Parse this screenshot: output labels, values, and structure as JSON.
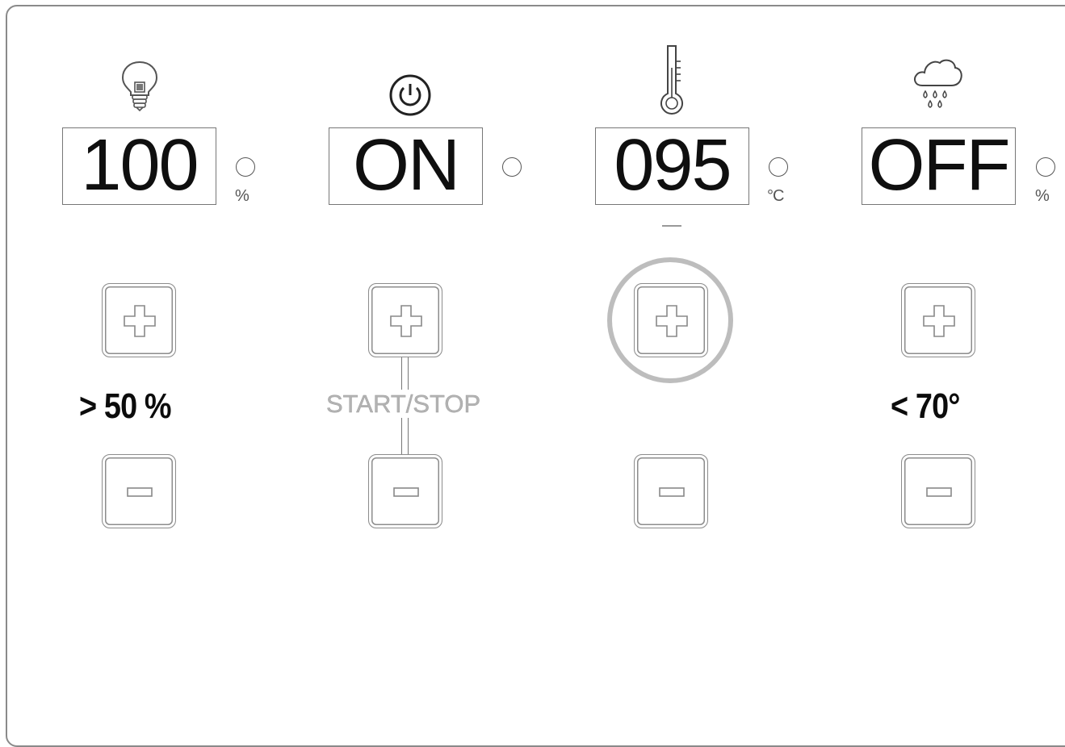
{
  "channels": [
    {
      "id": "light",
      "icon": "lightbulb-icon",
      "display_value": "100",
      "unit": "%",
      "condition": "> 50 %"
    },
    {
      "id": "power",
      "icon": "power-icon",
      "display_value": "ON",
      "unit": "",
      "condition": "",
      "center_label": "START/STOP"
    },
    {
      "id": "temperature",
      "icon": "thermometer-icon",
      "display_value": "095",
      "unit": "°C",
      "condition": "",
      "plus_highlighted": true
    },
    {
      "id": "rain",
      "icon": "rain-cloud-icon",
      "display_value": "OFF",
      "unit": "%",
      "condition": "< 70°"
    }
  ],
  "colors": {
    "display_text": "#0f0f0f",
    "border": "#8c8c8c",
    "highlight_ring": "#bdbdbd",
    "start_stop_text": "#b3b3b3"
  }
}
